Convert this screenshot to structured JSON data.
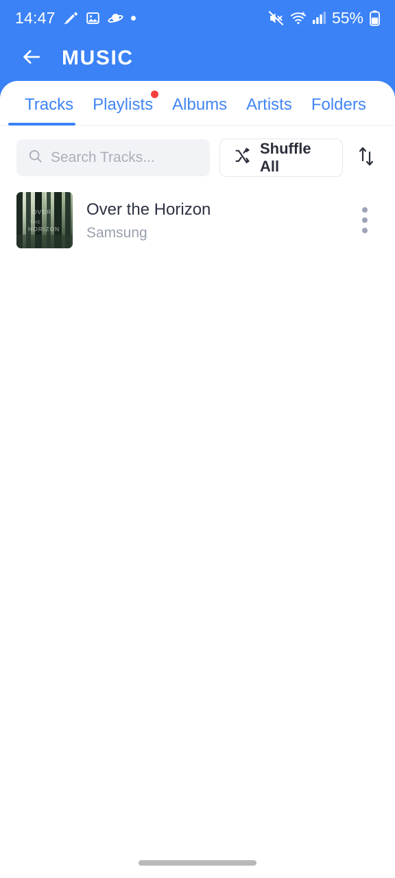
{
  "colors": {
    "header_blue": "#3B82F6",
    "tab_blue": "#4285F4",
    "badge_red": "#F2413C",
    "title_text": "#2D3142",
    "artist_text": "#9AA0AE",
    "search_bg": "#F1F3F6",
    "home_indicator": "#B9B9B9"
  },
  "status_bar": {
    "time": "14:47",
    "left_icons": [
      "pen-nib-icon",
      "image-icon",
      "planet-icon",
      "dot-indicator-icon"
    ],
    "right_icons": [
      "mute-icon",
      "wifi-6-icon",
      "cellular-signal-icon",
      "battery-icon"
    ],
    "battery_percent": "55%"
  },
  "app_bar": {
    "back_icon": "back-arrow-icon",
    "title": "MUSIC"
  },
  "tabs": {
    "items": [
      {
        "label": "Tracks",
        "active": true,
        "badge": false
      },
      {
        "label": "Playlists",
        "active": false,
        "badge": true
      },
      {
        "label": "Albums",
        "active": false,
        "badge": false
      },
      {
        "label": "Artists",
        "active": false,
        "badge": false
      },
      {
        "label": "Folders",
        "active": false,
        "badge": false
      }
    ]
  },
  "controls": {
    "search_placeholder": "Search Tracks...",
    "search_value": "",
    "search_icon": "search-icon",
    "shuffle_label": "Shuffle All",
    "shuffle_icon": "shuffle-icon",
    "sort_icon": "sort-arrows-icon"
  },
  "tracks": [
    {
      "title": "Over the Horizon",
      "artist": "Samsung",
      "artwork": "forest-album-art",
      "menu_icon": "more-vertical-icon"
    }
  ],
  "system_nav": {
    "home_indicator": "home-indicator"
  }
}
